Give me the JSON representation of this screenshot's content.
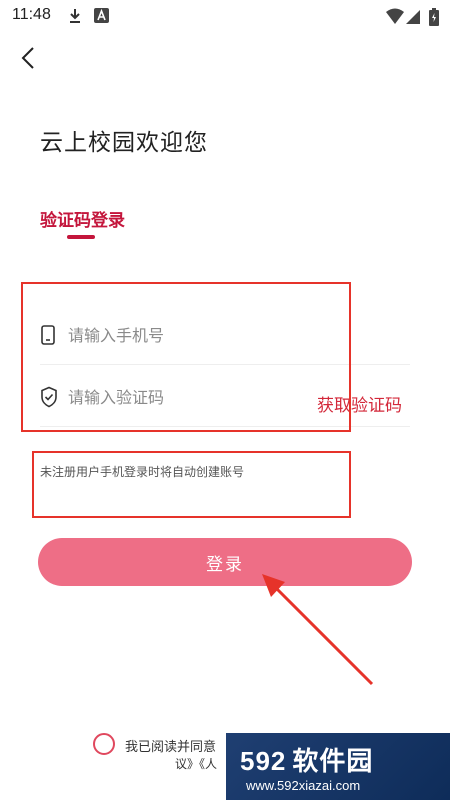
{
  "status_bar": {
    "time": "11:48"
  },
  "header": {
    "title": "云上校园欢迎您"
  },
  "tabs": {
    "active_label": "验证码登录"
  },
  "form": {
    "phone_placeholder": "请输入手机号",
    "code_placeholder": "请输入验证码",
    "get_code_label": "获取验证码",
    "notice": "未注册用户手机登录时将自动创建账号",
    "login_label": "登录"
  },
  "agreement": {
    "text_line1": "我已阅读并同意",
    "text_line2": "议》《人"
  },
  "watermark": {
    "logo_num": "592",
    "logo_text": "软件园",
    "url": "www.592xiazai.com"
  },
  "colors": {
    "accent": "#c4163c",
    "button": "#ee6e86",
    "annotation": "#e6332a"
  }
}
